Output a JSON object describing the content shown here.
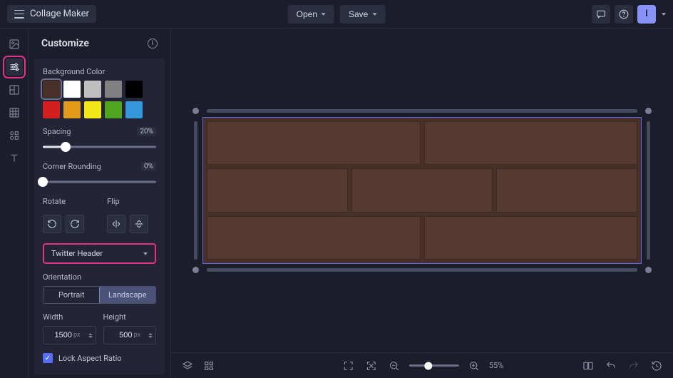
{
  "app": {
    "title": "Collage Maker"
  },
  "topbar": {
    "open_label": "Open",
    "save_label": "Save",
    "avatar_initial": "I"
  },
  "panel": {
    "title": "Customize",
    "bg_label": "Background Color",
    "colors_row1": [
      "#482f27",
      "#ffffff",
      "#bfbfbf",
      "#808080",
      "#000000"
    ],
    "colors_row2": [
      "#d31f1f",
      "#e29a1a",
      "#f2e719",
      "#4ea61f",
      "#3498db"
    ],
    "selected_color_index": 0,
    "spacing": {
      "label": "Spacing",
      "value": "20%",
      "pct": 20
    },
    "rounding": {
      "label": "Corner Rounding",
      "value": "0%",
      "pct": 0
    },
    "rotate_label": "Rotate",
    "flip_label": "Flip",
    "preset": {
      "value": "Twitter Header"
    },
    "orientation": {
      "label": "Orientation",
      "portrait": "Portrait",
      "landscape": "Landscape",
      "active": "landscape"
    },
    "width": {
      "label": "Width",
      "value": "1500",
      "unit": "px"
    },
    "height": {
      "label": "Height",
      "value": "500",
      "unit": "px"
    },
    "lock_label": "Lock Aspect Ratio",
    "lock_checked": true
  },
  "zoom": {
    "value": "55%"
  }
}
